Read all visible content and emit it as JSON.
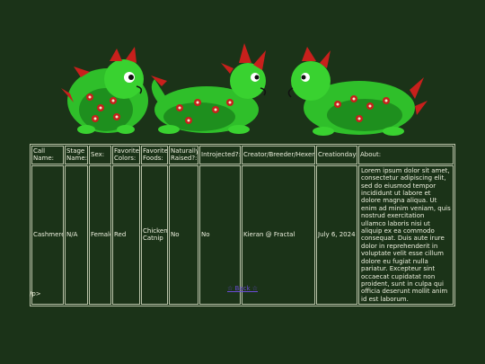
{
  "banner": {
    "images": [
      "dragon-left-image",
      "dragon-middle-image",
      "dragon-right-image"
    ]
  },
  "table": {
    "headers": [
      "Call Name:",
      "Stage Name:",
      "Sex:",
      "Favorite Colors:",
      "Favorite Foods:",
      "Naturally Raised?:",
      "Introjected?:",
      "Creator/Breeder/Hexer:",
      "Creationday:",
      "About:"
    ],
    "row": [
      "Cashmere",
      "N/A",
      "Female",
      "Red",
      "Chicken, Catnip",
      "No",
      "No",
      "Kieran @ Fractal",
      "July 6, 2024",
      "Lorem ipsum dolor sit amet, consectetur adipiscing elit, sed do eiusmod tempor incididunt ut labore et dolore magna aliqua. Ut enim ad minim veniam, quis nostrud exercitation ullamco laboris nisi ut aliquip ex ea commodo consequat. Duis aute irure dolor in reprehenderit in voluptate velit esse cillum dolore eu fugiat nulla pariatur. Excepteur sint occaecat cupidatat non proident, sunt in culpa qui officia deserunt mollit anim id est laborum."
    ]
  },
  "back_link": "☆ Back ☆",
  "stray_text": "/p>",
  "colors": {
    "background": "#1b3318",
    "link": "#6b4bd6",
    "dragon_green": "#2fbf2a",
    "dragon_red": "#c8201c"
  }
}
